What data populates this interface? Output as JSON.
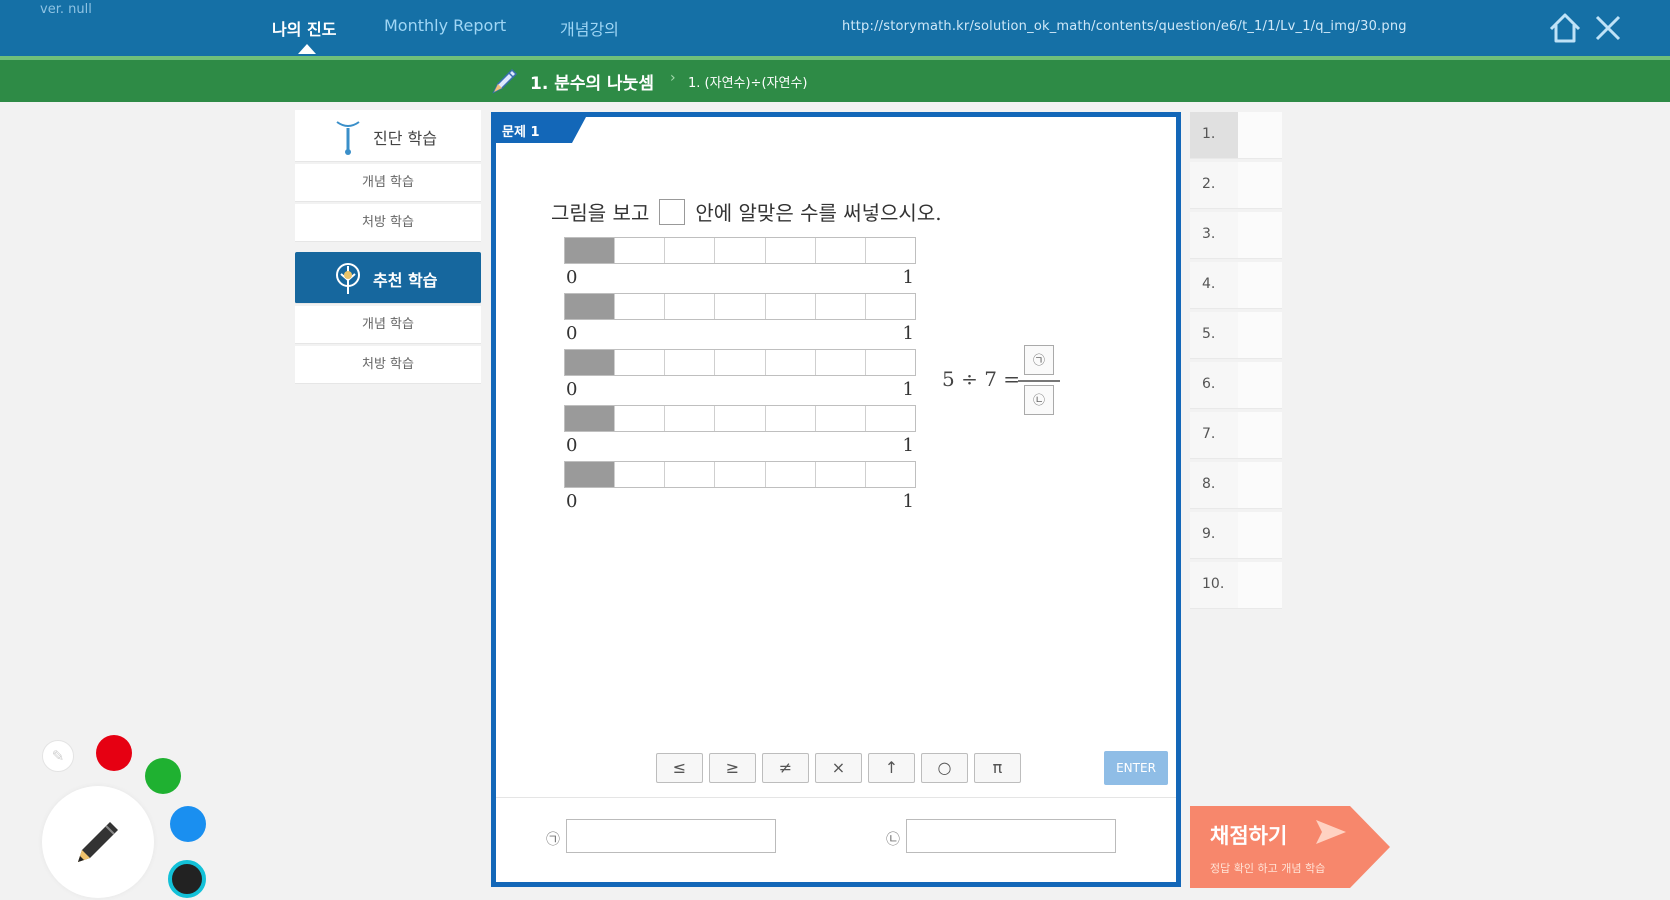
{
  "header": {
    "version": "ver. null",
    "tabs": [
      {
        "label": "나의 진도",
        "active": true
      },
      {
        "label": "Monthly Report",
        "active": false
      },
      {
        "label": "개념강의",
        "active": false
      }
    ],
    "url": "http://storymath.kr/solution_ok_math/contents/question/e6/t_1/1/Lv_1/q_img/30.png",
    "home_icon": "home-icon",
    "close_icon": "close-icon"
  },
  "unit_bar": {
    "title": "1. 분수의 나눗셈",
    "separator": "›",
    "subtitle": "1. (자연수)÷(자연수)"
  },
  "sidebar": {
    "sections": [
      {
        "label": "진단 학습",
        "icon": "diagnosis-icon",
        "selected": false,
        "items": [
          "개념 학습",
          "처방 학습"
        ]
      },
      {
        "label": "추천 학습",
        "icon": "recommend-icon",
        "selected": true,
        "items": [
          "개념 학습",
          "처방 학습"
        ]
      }
    ]
  },
  "problem": {
    "tab_label": "문제 1",
    "question_before": "그림을 보고",
    "question_after": "안에 알맞은 수를 써넣으시오.",
    "bar_count": 5,
    "cells_per_bar": 7,
    "filled_cells": 1,
    "tick_start": "0",
    "tick_end": "1",
    "equation": "5 ÷ 7 =",
    "numerator_mark": "㉠",
    "denominator_mark": "㉡",
    "symbols": [
      "≤",
      "≥",
      "≠",
      "×",
      "↑",
      "○",
      "π"
    ],
    "enter_label": "ENTER",
    "answers": [
      {
        "mark": "㉠",
        "value": ""
      },
      {
        "mark": "㉡",
        "value": ""
      }
    ]
  },
  "question_list": {
    "items": [
      "1.",
      "2.",
      "3.",
      "4.",
      "5.",
      "6.",
      "7.",
      "8.",
      "9.",
      "10."
    ],
    "current": 0
  },
  "grade_button": {
    "title": "채점하기",
    "subtitle": "정답 확인 하고 개념 학습",
    "color": "#f7876c"
  },
  "drawing_tools": {
    "pen_icon": "pencil-icon",
    "colors": [
      "#e60012",
      "#1fb131",
      "#1a8ff0",
      "#222222"
    ],
    "selected_color": "#222222"
  }
}
